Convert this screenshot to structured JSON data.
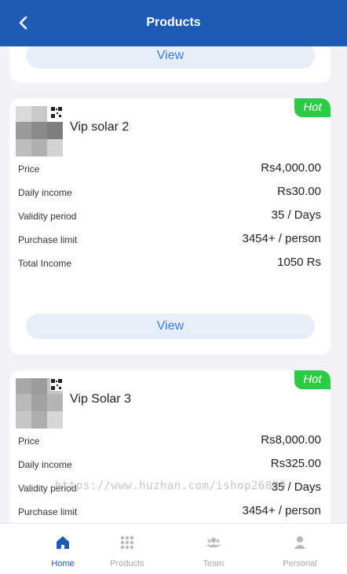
{
  "header": {
    "title": "Products"
  },
  "view_label": "View",
  "watermark": "https://www.huzhan.com/ishop26889",
  "products": [
    {
      "badge": "Hot",
      "name": "Vip solar 2",
      "rows": [
        {
          "label": "Price",
          "value": "Rs4,000.00"
        },
        {
          "label": "Daily income",
          "value": "Rs30.00"
        },
        {
          "label": "Validity period",
          "value": "35 / Days"
        },
        {
          "label": "Purchase limit",
          "value": "3454+ / person"
        },
        {
          "label": "Total Income",
          "value": "1050 Rs"
        }
      ]
    },
    {
      "badge": "Hot",
      "name": "Vip Solar 3",
      "rows": [
        {
          "label": "Price",
          "value": "Rs8,000.00"
        },
        {
          "label": "Daily income",
          "value": "Rs325.00"
        },
        {
          "label": "Validity period",
          "value": "35 / Days"
        },
        {
          "label": "Purchase limit",
          "value": "3454+ / person"
        }
      ]
    }
  ],
  "tabs": [
    {
      "label": "Home",
      "icon": "home-icon",
      "active": true
    },
    {
      "label": "Products",
      "icon": "grid-icon",
      "active": false
    },
    {
      "label": "Team",
      "icon": "team-icon",
      "active": false
    },
    {
      "label": "Personal",
      "icon": "person-icon",
      "active": false
    }
  ],
  "colors": {
    "header": "#1e5bb5",
    "hot_badge": "#2bcb45",
    "view_button_bg": "#e6eef9",
    "view_button_text": "#3a7bd5",
    "tab_active": "#1e5bb5",
    "tab_inactive": "#a7a7ad"
  }
}
